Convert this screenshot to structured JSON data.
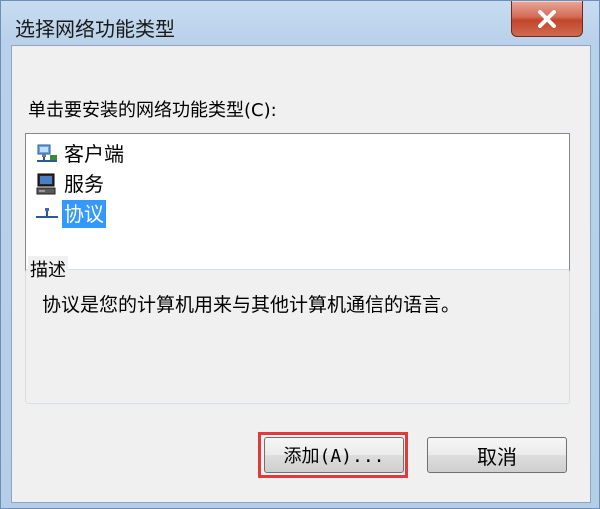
{
  "window": {
    "title": "选择网络功能类型"
  },
  "dialog": {
    "prompt": "单击要安装的网络功能类型(C):",
    "items": [
      {
        "label": "客户端",
        "icon": "client-network-icon",
        "selected": false
      },
      {
        "label": "服务",
        "icon": "service-computer-icon",
        "selected": false
      },
      {
        "label": "协议",
        "icon": "protocol-network-icon",
        "selected": true
      }
    ],
    "description_legend": "描述",
    "description_text": "协议是您的计算机用来与其他计算机通信的语言。",
    "add_button": "添加(A)...",
    "cancel_button": "取消"
  },
  "colors": {
    "selection": "#3399ff",
    "highlight_border": "#e23a3a",
    "close_button": "#c2462c"
  }
}
